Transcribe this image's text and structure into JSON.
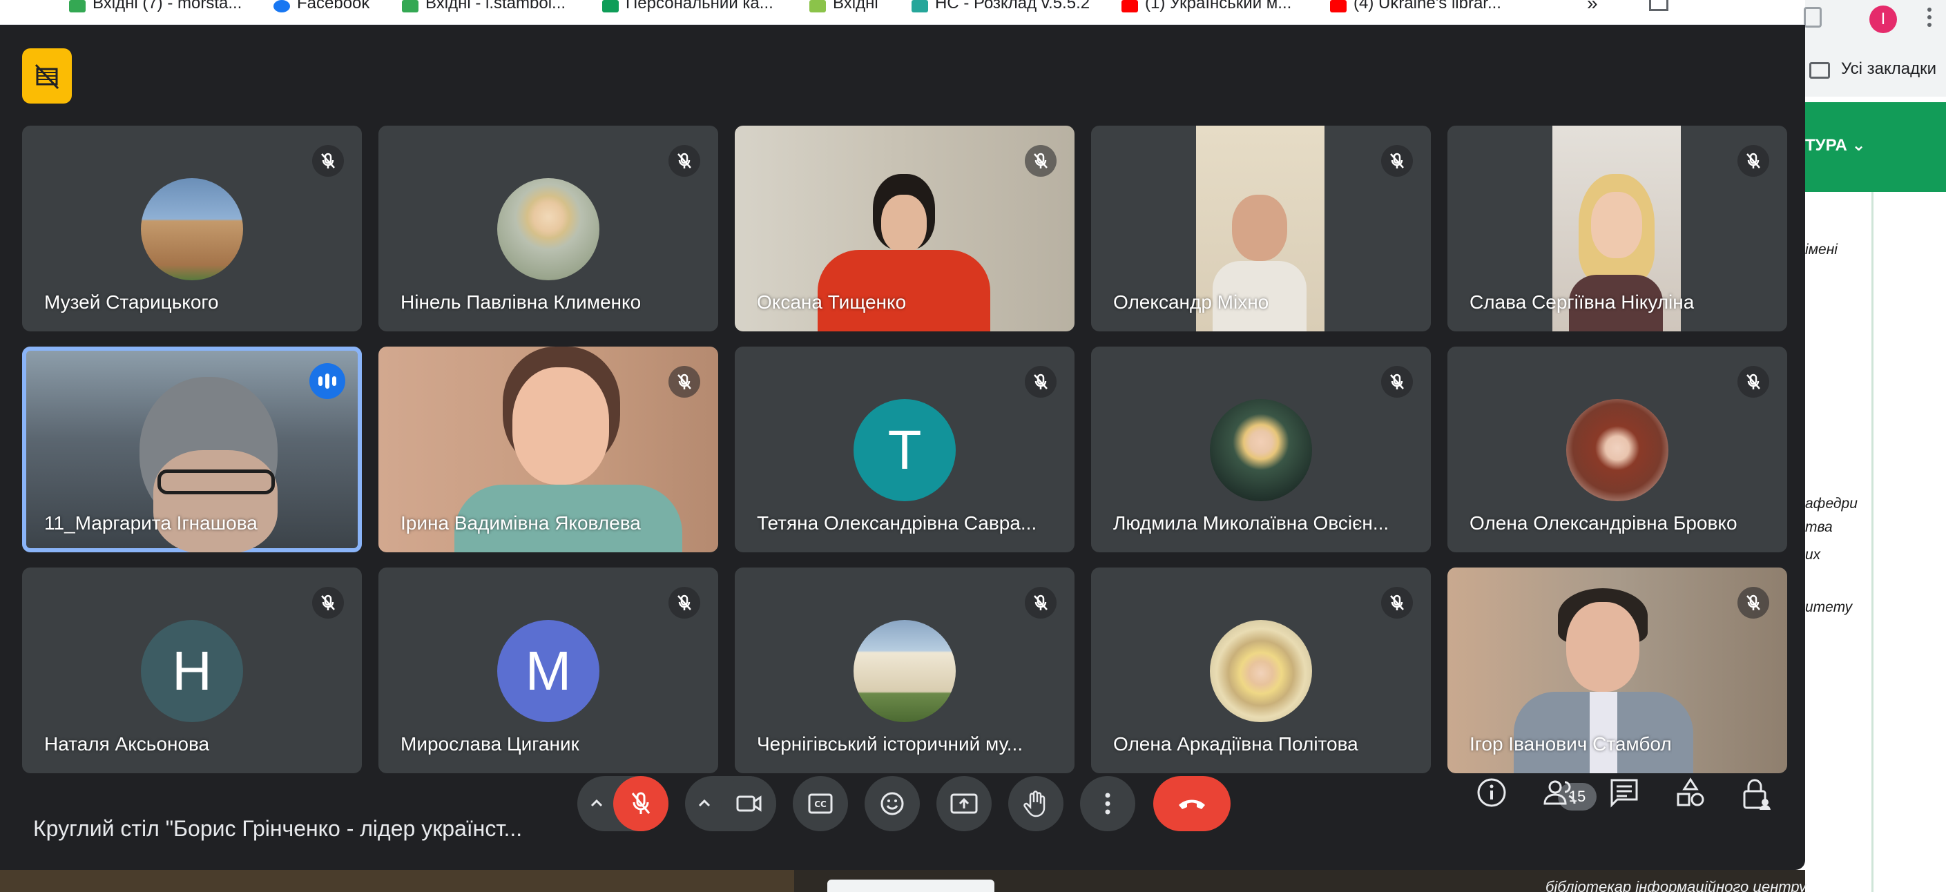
{
  "browser": {
    "bookmarks": [
      {
        "label": "Вхідні (7) - morsta...",
        "icon_color": "#34a853"
      },
      {
        "label": "Facebook",
        "icon_color": "#1877f2"
      },
      {
        "label": "Вхідні - i.stambol...",
        "icon_color": "#34a853"
      },
      {
        "label": "Персональний ка...",
        "icon_color": "#0f9d58"
      },
      {
        "label": "Вхідні",
        "icon_color": "#8bc34a"
      },
      {
        "label": "НС - Розклад v.5.5.2",
        "icon_color": "#26a69a"
      },
      {
        "label": "(1) Український м...",
        "icon_color": "#ff0000"
      },
      {
        "label": "(4) Ukraine's librar...",
        "icon_color": "#ff0000"
      }
    ],
    "more_bookmarks": "»",
    "all_bookmarks_label": "Усі закладки",
    "profile_initial": "I",
    "page_nav_label": "ТУРА ⌄",
    "page_snippets": [
      "імені",
      "афедри",
      "тва",
      "их",
      "итету"
    ],
    "footer_snippet": "бібліотекар інформаційного центру"
  },
  "meet": {
    "participants": [
      {
        "name": "Музей Старицького",
        "type": "photo",
        "photo_bg": "#6b8fb8"
      },
      {
        "name": "Нінель Павлівна Клименко",
        "type": "photo",
        "photo_bg": "#b9c0b0"
      },
      {
        "name": "Оксана Тищенко",
        "type": "video",
        "photo_bg": "#c9c3b5"
      },
      {
        "name": "Олександр Міхно",
        "type": "video",
        "photo_bg": "#d9cdb6"
      },
      {
        "name": "Слава Сергіївна Нікуліна",
        "type": "video",
        "photo_bg": "#c7b7a5"
      },
      {
        "name": "11_Маргарита Ігнашова",
        "type": "video",
        "photo_bg": "#5b6670",
        "speaking": true
      },
      {
        "name": "Ірина Вадимівна Яковлева",
        "type": "video",
        "photo_bg": "#c69a7e"
      },
      {
        "name": "Тетяна Олександрівна Савра...",
        "type": "letter",
        "letter": "T",
        "avatar_bg": "#12939a"
      },
      {
        "name": "Людмила Миколаївна Овсієн...",
        "type": "photo",
        "photo_bg": "#23352e"
      },
      {
        "name": "Олена Олександрівна Бровко",
        "type": "photo",
        "photo_bg": "#7a3b2c"
      },
      {
        "name": "Наталя Аксьонова",
        "type": "letter",
        "letter": "H",
        "avatar_bg": "#3d5c63"
      },
      {
        "name": "Мирослава Циганик",
        "type": "letter",
        "letter": "M",
        "avatar_bg": "#5b6fd1"
      },
      {
        "name": "Чернігівський історичний му...",
        "type": "photo",
        "photo_bg": "#8aa6c4"
      },
      {
        "name": "Олена Аркадіївна Політова",
        "type": "photo",
        "photo_bg": "#c9b07a"
      },
      {
        "name": "Ігор Іванович Стамбол",
        "type": "video",
        "photo_bg": "#a89a8a"
      }
    ],
    "meeting_title": "Круглий стіл \"Борис Грінченко - лідер українст...",
    "participant_count": "15",
    "colors": {
      "accent": "#8ab4f8",
      "danger": "#ea4335",
      "host": "#fbbc04",
      "tile": "#3c4043",
      "bg": "#202124"
    }
  }
}
